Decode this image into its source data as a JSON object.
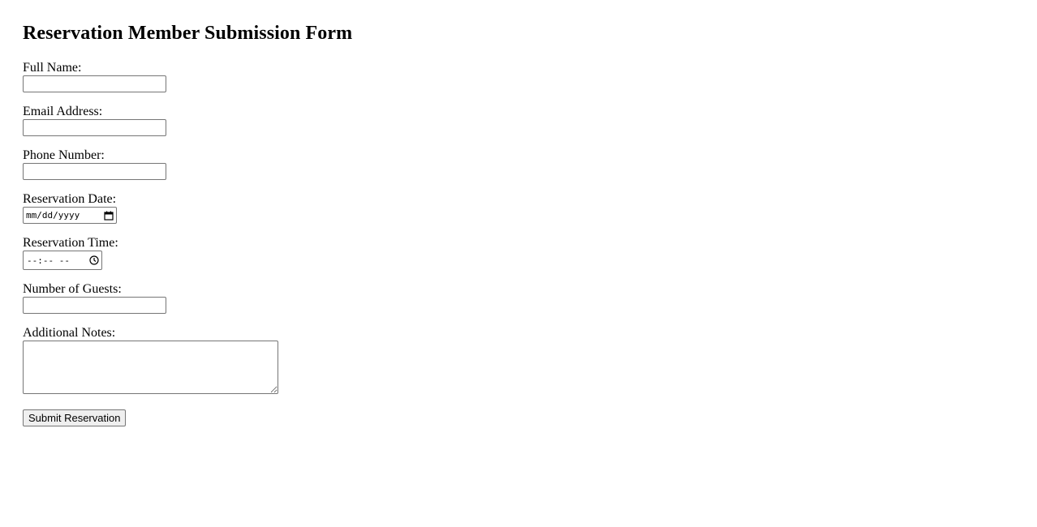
{
  "page": {
    "title": "Reservation Member Submission Form"
  },
  "form": {
    "full_name": {
      "label": "Full Name:",
      "value": ""
    },
    "email": {
      "label": "Email Address:",
      "value": ""
    },
    "phone": {
      "label": "Phone Number:",
      "value": ""
    },
    "date": {
      "label": "Reservation Date:",
      "placeholder": "mm/dd/yyyy",
      "icon": "calendar-icon"
    },
    "time": {
      "label": "Reservation Time:",
      "placeholder": "--:-- --",
      "icon": "clock-icon"
    },
    "guests": {
      "label": "Number of Guests:",
      "value": ""
    },
    "notes": {
      "label": "Additional Notes:",
      "value": ""
    },
    "submit_label": "Submit Reservation"
  }
}
